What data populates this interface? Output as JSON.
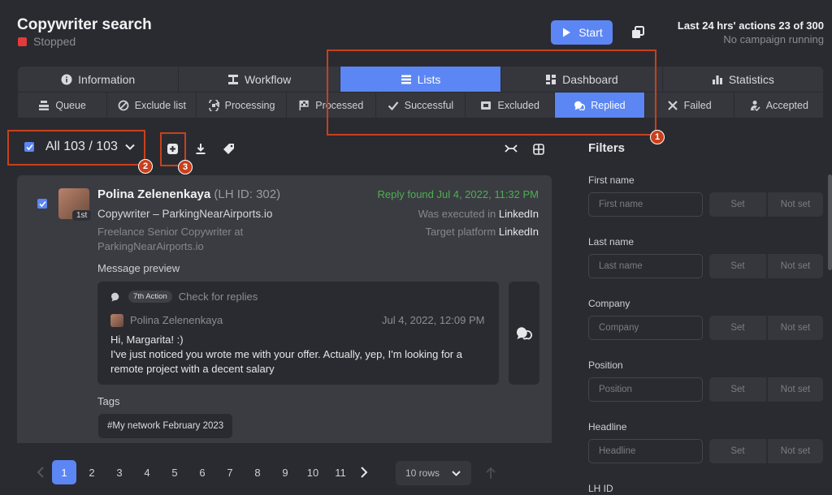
{
  "header": {
    "title": "Copywriter search",
    "status": "Stopped",
    "start_label": "Start",
    "quota_line1": "Last 24 hrs' actions 23 of 300",
    "quota_line2": "No campaign running"
  },
  "main_tabs": [
    {
      "label": "Information",
      "icon": "info-icon"
    },
    {
      "label": "Workflow",
      "icon": "workflow-icon"
    },
    {
      "label": "Lists",
      "icon": "list-icon",
      "active": true
    },
    {
      "label": "Dashboard",
      "icon": "dashboard-icon"
    },
    {
      "label": "Statistics",
      "icon": "stats-icon"
    }
  ],
  "sub_tabs": [
    {
      "label": "Queue",
      "icon": "queue-icon"
    },
    {
      "label": "Exclude list",
      "icon": "block-icon"
    },
    {
      "label": "Processing",
      "icon": "processing-icon"
    },
    {
      "label": "Processed",
      "icon": "flag-icon"
    },
    {
      "label": "Successful",
      "icon": "check-icon"
    },
    {
      "label": "Excluded",
      "icon": "excluded-icon"
    },
    {
      "label": "Replied",
      "icon": "chat-icon",
      "active": true
    },
    {
      "label": "Failed",
      "icon": "x-icon"
    },
    {
      "label": "Accepted",
      "icon": "accepted-icon"
    }
  ],
  "annotations": {
    "b1": "1",
    "b2": "2",
    "b3": "3"
  },
  "selection": {
    "label": "All 103 / 103"
  },
  "profile": {
    "name": "Polina Zelenenkaya",
    "lh_id": "(LH ID: 302)",
    "degree": "1st",
    "role": "Copywriter – ParkingNearAirports.io",
    "headline": "Freelance Senior Copywriter at ParkingNearAirports.io",
    "reply_found": "Reply found Jul 4, 2022, 11:32 PM",
    "executed_prefix": "Was executed in",
    "executed_in": "LinkedIn",
    "target_prefix": "Target platform",
    "target_platform": "LinkedIn",
    "message_preview_label": "Message preview",
    "action_pill": "7th Action",
    "action_name": "Check for replies",
    "sender": "Polina Zelenenkaya",
    "message_date": "Jul 4, 2022, 12:09 PM",
    "message_text": "Hi, Margarita! :)\nI've just noticed you wrote me with your offer. Actually, yep, I'm looking for a remote project with a decent salary",
    "tags_label": "Tags",
    "tag": "#My network February 2023"
  },
  "pagination": {
    "pages": [
      "1",
      "2",
      "3",
      "4",
      "5",
      "6",
      "7",
      "8",
      "9",
      "10",
      "11"
    ],
    "current": "1",
    "rows_label": "10 rows"
  },
  "filters": {
    "title": "Filters",
    "set_label": "Set",
    "not_set_label": "Not set",
    "fields": [
      {
        "label": "First name",
        "placeholder": "First name"
      },
      {
        "label": "Last name",
        "placeholder": "Last name"
      },
      {
        "label": "Company",
        "placeholder": "Company"
      },
      {
        "label": "Position",
        "placeholder": "Position"
      },
      {
        "label": "Headline",
        "placeholder": "Headline"
      }
    ],
    "next_label": "LH ID"
  },
  "colors": {
    "accent": "#5b86f3",
    "highlight": "#c8401d",
    "success": "#4caf50",
    "stopped": "#e23b3b"
  }
}
